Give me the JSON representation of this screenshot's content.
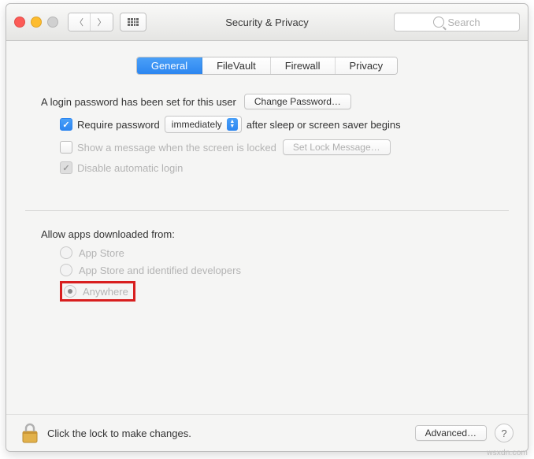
{
  "window": {
    "title": "Security & Privacy"
  },
  "search": {
    "placeholder": "Search"
  },
  "tabs": [
    "General",
    "FileVault",
    "Firewall",
    "Privacy"
  ],
  "active_tab_index": 0,
  "general": {
    "password_set_label": "A login password has been set for this user",
    "change_password_button": "Change Password…",
    "require_password_prefix": "Require password",
    "require_delay": "immediately",
    "require_password_suffix": "after sleep or screen saver begins",
    "show_message_label": "Show a message when the screen is locked",
    "set_lock_message_button": "Set Lock Message…",
    "disable_auto_login_label": "Disable automatic login",
    "allow_apps_label": "Allow apps downloaded from:",
    "allow_options": [
      "App Store",
      "App Store and identified developers",
      "Anywhere"
    ],
    "allow_selected_index": 2
  },
  "footer": {
    "lock_text": "Click the lock to make changes.",
    "advanced_button": "Advanced…",
    "help": "?"
  },
  "watermark": "wsxdn.com"
}
